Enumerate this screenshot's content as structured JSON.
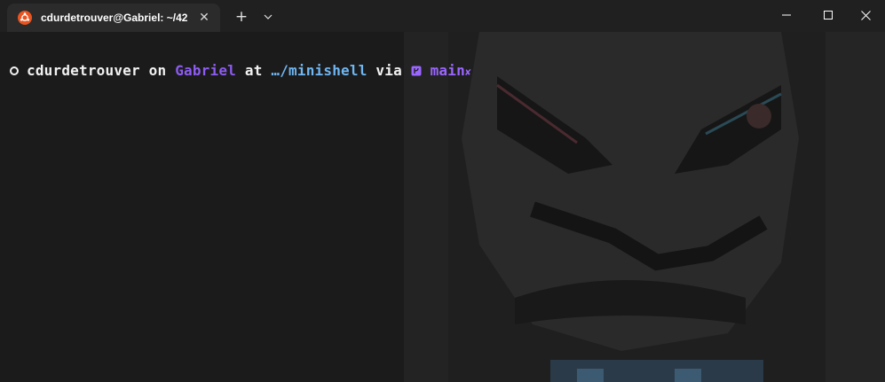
{
  "window": {
    "tab_title": "cdurdetrouver@Gabriel: ~/42",
    "tab_icon": "ubuntu-icon",
    "tab_close_glyph": "✕",
    "new_tab_glyph": "+",
    "dropdown_icon": "chevron-down-icon",
    "controls": [
      "minimize-icon",
      "maximize-icon",
      "close-icon"
    ]
  },
  "prompt": {
    "user": "cdurdetrouver",
    "on": "on",
    "host": "Gabriel",
    "at": "at",
    "path": "…/minishell",
    "via": "via",
    "branch_icon": "git-branch-icon",
    "branch": "main",
    "status": "✘"
  },
  "colors": {
    "titlebar": "#202020",
    "tab": "#2b2b2b",
    "terminal_bg": "#1b1b1b",
    "host": "#8c5cf0",
    "path": "#6fb6f2",
    "branch": "#9a66ff",
    "ubuntu_orange": "#e95420"
  }
}
